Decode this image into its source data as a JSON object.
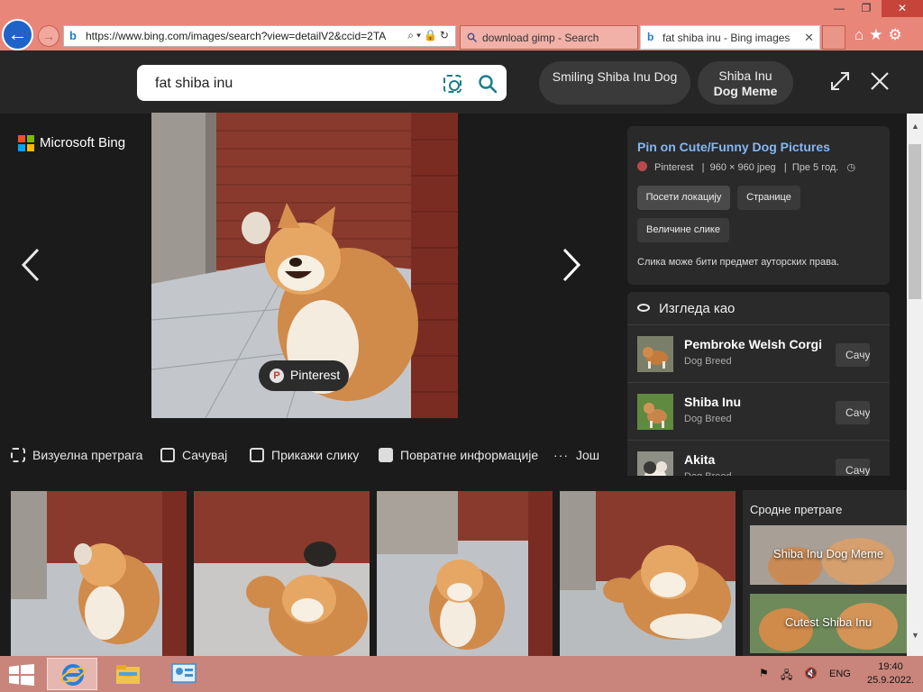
{
  "browser": {
    "address": "https://www.bing.com/images/search?view=detailV2&ccid=2TA",
    "tabs": [
      {
        "label": "download gimp - Search"
      },
      {
        "label": "fat shiba inu - Bing images"
      }
    ],
    "colors": {
      "chrome": "#e9867a",
      "accent": "#1f63c9"
    }
  },
  "header": {
    "query": "fat shiba inu",
    "suggestions": [
      {
        "label": "Smiling Shiba Inu Dog"
      },
      {
        "line1": "Shiba Inu",
        "line2": "Dog Meme"
      }
    ]
  },
  "brand": {
    "name": "Microsoft Bing"
  },
  "viewer": {
    "source": "Pinterest",
    "actions": [
      {
        "label": "Визуелна претрага"
      },
      {
        "label": "Сачувај"
      },
      {
        "label": "Прикажи слику"
      },
      {
        "label": "Повратне информације"
      },
      {
        "label": "Још"
      }
    ]
  },
  "info": {
    "title": "Pin on Cute/Funny Dog Pictures",
    "site": "Pinterest",
    "size": "960 × 960 jpeg",
    "age": "Пре 5 год.",
    "buttons": {
      "visit": "Посети локацију",
      "pages": "Странице",
      "sizes": "Величине слике"
    },
    "copyright": "Слика може бити предмет ауторских права."
  },
  "looks_like": {
    "heading": "Изгледа као",
    "items": [
      {
        "name": "Pembroke Welsh Corgi",
        "type": "Dog Breed",
        "button": "Сачу"
      },
      {
        "name": "Shiba Inu",
        "type": "Dog Breed",
        "button": "Сачу"
      },
      {
        "name": "Akita",
        "type": "Dog Breed",
        "button": "Сачу"
      }
    ]
  },
  "related": {
    "heading": "Сродне претраге",
    "items": [
      {
        "label": "Shiba Inu Dog Meme"
      },
      {
        "label": "Cutest Shiba Inu"
      }
    ]
  },
  "taskbar": {
    "language": "ENG",
    "time": "19:40",
    "date": "25.9.2022."
  }
}
